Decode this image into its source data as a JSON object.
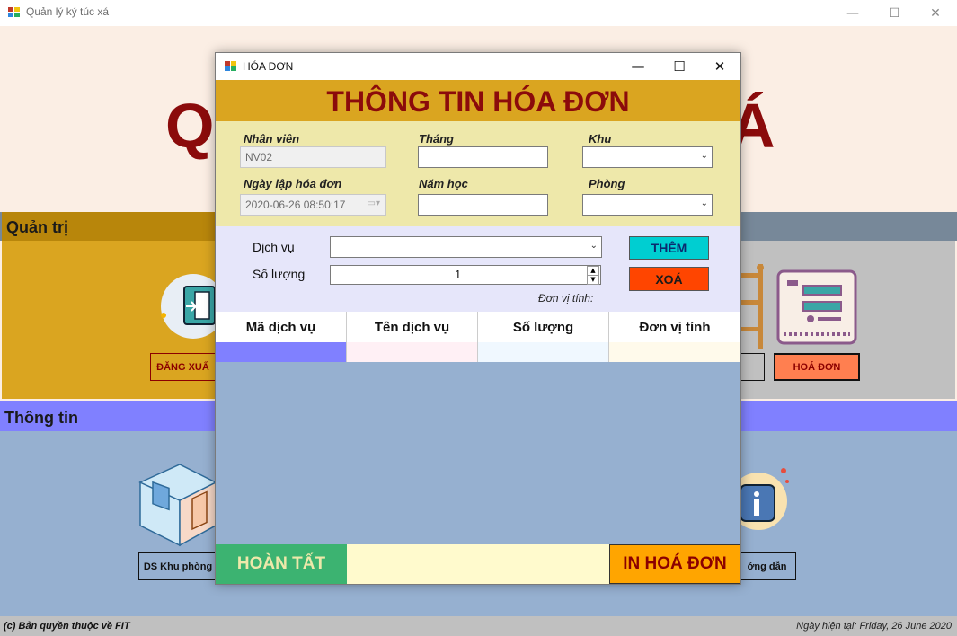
{
  "main_window": {
    "title": "Quản lý ký túc xá",
    "heading_left": "Q",
    "heading_right": "Á",
    "admin_section_title": "Quản trị",
    "info_section_title": "Thông tin",
    "buttons": {
      "logout": "ĐĂNG XUẤ",
      "invoice": "HOÁ ĐƠN",
      "area_list": "DS Khu phòng",
      "guide": "ớng dẫn"
    },
    "copyright": "(c) Bản quyền thuộc về FIT",
    "today": "Ngày hiện tại: Friday, 26 June 2020",
    "window_controls": {
      "minimize": "—",
      "maximize": "☐",
      "close": "✕"
    }
  },
  "dialog": {
    "title": "HÓA ĐƠN",
    "heading": "THÔNG TIN HÓA ĐƠN",
    "form": {
      "employee_label": "Nhân viên",
      "employee_value": "NV02",
      "date_label": "Ngày lập hóa đơn",
      "date_value": "2020-06-26 08:50:17",
      "month_label": "Tháng",
      "month_value": "",
      "year_label": "Năm học",
      "year_value": "",
      "area_label": "Khu",
      "area_value": "",
      "room_label": "Phòng",
      "room_value": ""
    },
    "service": {
      "service_label": "Dịch vụ",
      "service_value": "",
      "quantity_label": "Số lượng",
      "quantity_value": "1",
      "unit_label": "Đơn vị tính:",
      "add_button": "THÊM",
      "delete_button": "XOÁ"
    },
    "grid": {
      "columns": [
        "Mã dịch vụ",
        "Tên dịch vụ",
        "Số lượng",
        "Đơn vị tính"
      ],
      "column_colors": [
        "#8080ff",
        "#fff0f5",
        "#f0f8ff",
        "#fffaeb"
      ]
    },
    "footer": {
      "finish_button": "HOÀN TẤT",
      "print_button": "IN HOÁ ĐƠN"
    },
    "window_controls": {
      "minimize": "—",
      "maximize": "☐",
      "close": "✕"
    }
  }
}
